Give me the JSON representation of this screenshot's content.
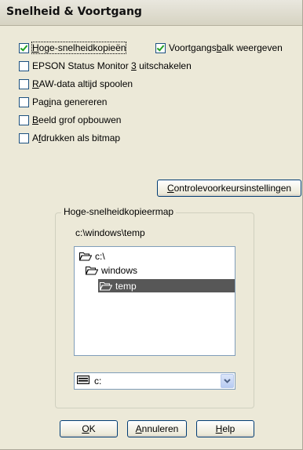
{
  "dialog": {
    "title": "Snelheid & Voortgang"
  },
  "options": {
    "high_speed_copy": {
      "label_pre": "",
      "label_u": "H",
      "label_post": "oge-snelheidkopieën",
      "checked": true
    },
    "progress_bar": {
      "label_pre": "Voortgangs",
      "label_u": "b",
      "label_post": "alk weergeven",
      "checked": true
    },
    "status_monitor": {
      "label_pre": "EPSON Status Monitor ",
      "label_u": "3",
      "label_post": " uitschakelen",
      "checked": false
    },
    "raw_spool": {
      "label_pre": "",
      "label_u": "R",
      "label_post": "AW-data altijd spoolen",
      "checked": false
    },
    "page_generate": {
      "label_pre": "Pag",
      "label_u": "i",
      "label_post": "na genereren",
      "checked": false
    },
    "coarse_build": {
      "label_pre": "",
      "label_u": "B",
      "label_post": "eeld grof opbouwen",
      "checked": false
    },
    "bitmap_print": {
      "label_pre": "A",
      "label_u": "f",
      "label_post": "drukken als bitmap",
      "checked": false
    }
  },
  "buttons": {
    "control_settings": {
      "label_u": "C",
      "label_post": "ontrolevoorkeursinstellingen"
    },
    "ok": {
      "label_u": "O",
      "label_post": "K"
    },
    "cancel": {
      "label_u": "A",
      "label_post": "nnuleren"
    },
    "help": {
      "label_u": "H",
      "label_post": "elp"
    }
  },
  "copy_folder": {
    "group_title": "Hoge-snelheidkopieermap",
    "current_path": "c:\\windows\\temp",
    "tree": [
      {
        "label": "c:\\",
        "selected": false
      },
      {
        "label": "windows",
        "selected": false
      },
      {
        "label": "temp",
        "selected": true
      }
    ],
    "drive_value": "c:"
  },
  "colors": {
    "dialog_bg": "#ece9d8",
    "selection": "#575757",
    "check": "#21a121",
    "button_border": "#003c74"
  },
  "icons": {
    "folder": "open-folder-icon",
    "drive": "drive-icon",
    "dropdown": "chevron-down-icon"
  }
}
